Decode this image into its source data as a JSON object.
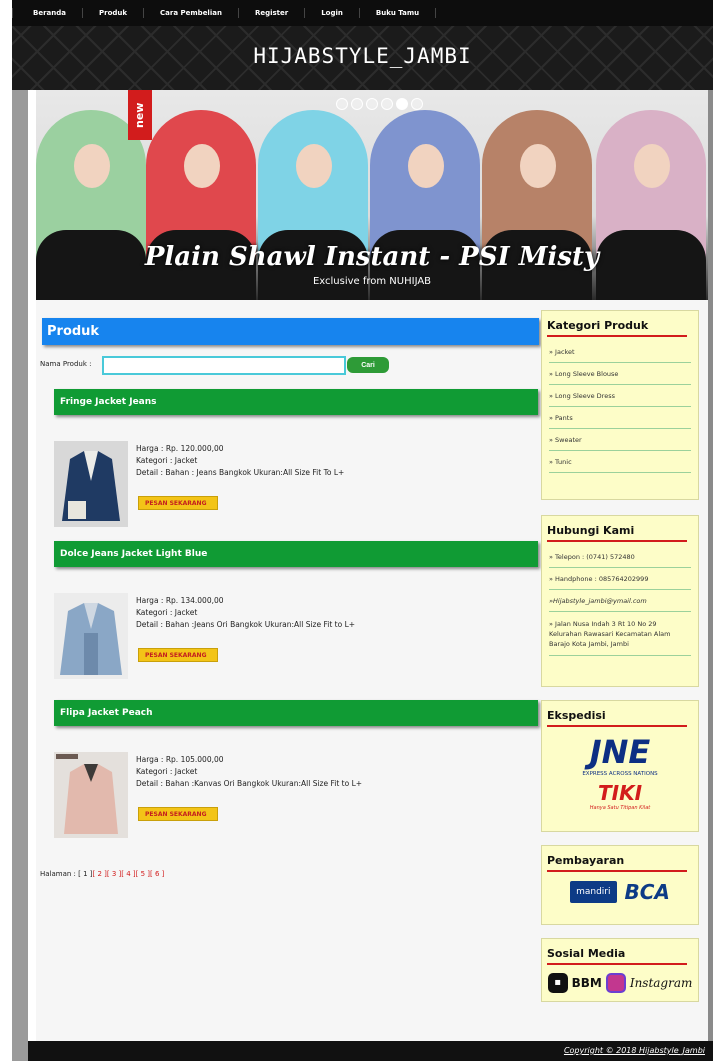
{
  "nav": {
    "items": [
      "Beranda",
      "Produk",
      "Cara Pembelian",
      "Register",
      "Login",
      "Buku Tamu"
    ]
  },
  "header": {
    "site_title": "HIJABSTYLE_JAMBI"
  },
  "banner": {
    "badge": "new",
    "caption": "Plain Shawl Instant - PSI Misty",
    "subcaption": "Exclusive from NUHIJAB",
    "slide_count": 6,
    "active_slide": 5
  },
  "main": {
    "title": "Produk",
    "search": {
      "label": "Nama Produk :",
      "value": "",
      "button": "Cari"
    },
    "products": [
      {
        "name": "Fringe Jacket Jeans",
        "harga": "Harga : Rp. 120.000,00",
        "kategori": "Kategori : Jacket",
        "detail": "Detail : Bahan : Jeans Bangkok Ukuran:All Size Fit To L+",
        "button": "PESAN SEKARANG"
      },
      {
        "name": "Dolce Jeans Jacket Light Blue",
        "harga": "Harga : Rp. 134.000,00",
        "kategori": "Kategori : Jacket",
        "detail": "Detail : Bahan :Jeans Ori Bangkok Ukuran:All Size Fit to L+",
        "button": "PESAN SEKARANG"
      },
      {
        "name": "Flipa Jacket Peach",
        "harga": "Harga : Rp. 105.000,00",
        "kategori": "Kategori : Jacket",
        "detail": "Detail : Bahan :Kanvas Ori Bangkok Ukuran:All Size Fit to L+",
        "button": "PESAN SEKARANG"
      }
    ],
    "pagination": {
      "label": "Halaman :",
      "current": "[ 1 ]",
      "pages": [
        "[ 2 ]",
        "[ 3 ]",
        "[ 4 ]",
        "[ 5 ]",
        "[ 6 ]"
      ]
    }
  },
  "sidebar": {
    "kategori": {
      "title": "Kategori Produk",
      "items": [
        "» Jacket",
        "» Long Sleeve Blouse",
        "» Long Sleeve Dress",
        "» Pants",
        "» Sweater",
        "» Tunic"
      ]
    },
    "hubungi": {
      "title": "Hubungi Kami",
      "items": [
        "» Telepon : (0741) 572480",
        "» Handphone : 085764202999",
        "»Hijabstyle_jambi@ymail.com",
        "» Jalan Nusa Indah 3 Rt 10 No 29 Kelurahan Rawasari Kecamatan Alam Barajo Kota Jambi, Jambi"
      ]
    },
    "ekspedisi": {
      "title": "Ekspedisi",
      "jne": "JNE",
      "jne_tagline": "EXPRESS ACROSS NATIONS",
      "tiki": "TIKI",
      "tiki_tagline": "Hanya Satu Titipan Kilat"
    },
    "pembayaran": {
      "title": "Pembayaran",
      "mandiri": "mandiri",
      "bca": "BCA"
    },
    "sosial": {
      "title": "Sosial Media",
      "bbm": "BBM",
      "instagram": "Instagram"
    }
  },
  "footer": {
    "copyright": "Copyright © 2018 Hijabstyle_Jambi"
  },
  "colors": {
    "accent_blue": "#1784ee",
    "accent_green": "#109b34",
    "sidebar_bg": "#fdfdc8",
    "red": "#d21c1c"
  }
}
